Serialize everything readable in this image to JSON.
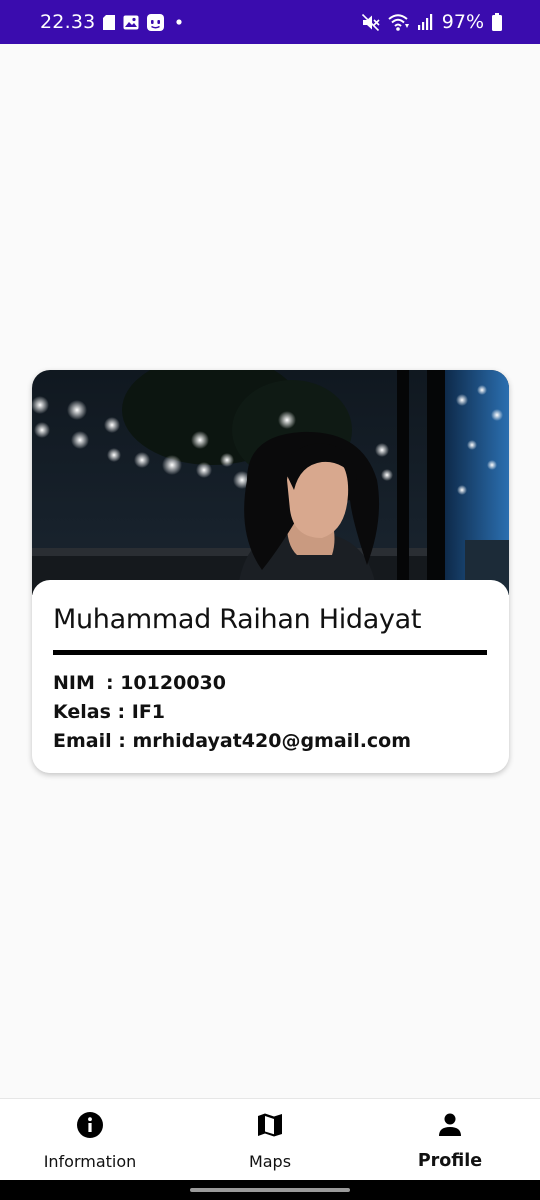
{
  "status_bar": {
    "time": "22.33",
    "battery": "97%",
    "bg_color": "#3a0cae",
    "left_icons": [
      "sim-card-icon",
      "gallery-icon",
      "app-notification-icon",
      "dot-icon"
    ],
    "right_icons": [
      "mute-icon",
      "wifi-icon",
      "signal-icon",
      "battery-icon"
    ]
  },
  "profile": {
    "name": "Muhammad Raihan Hidayat",
    "nim_label": "NIM",
    "nim_value": ": 10120030",
    "kelas_label": "Kelas",
    "kelas_value": ": IF1",
    "email_label": "Email",
    "email_value": ": mrhidayat420@gmail.com",
    "photo": "profile-photo"
  },
  "nav": {
    "items": [
      {
        "label": "Information",
        "icon": "info-icon",
        "active": false
      },
      {
        "label": "Maps",
        "icon": "map-icon",
        "active": false
      },
      {
        "label": "Profile",
        "icon": "person-icon",
        "active": true
      }
    ]
  }
}
